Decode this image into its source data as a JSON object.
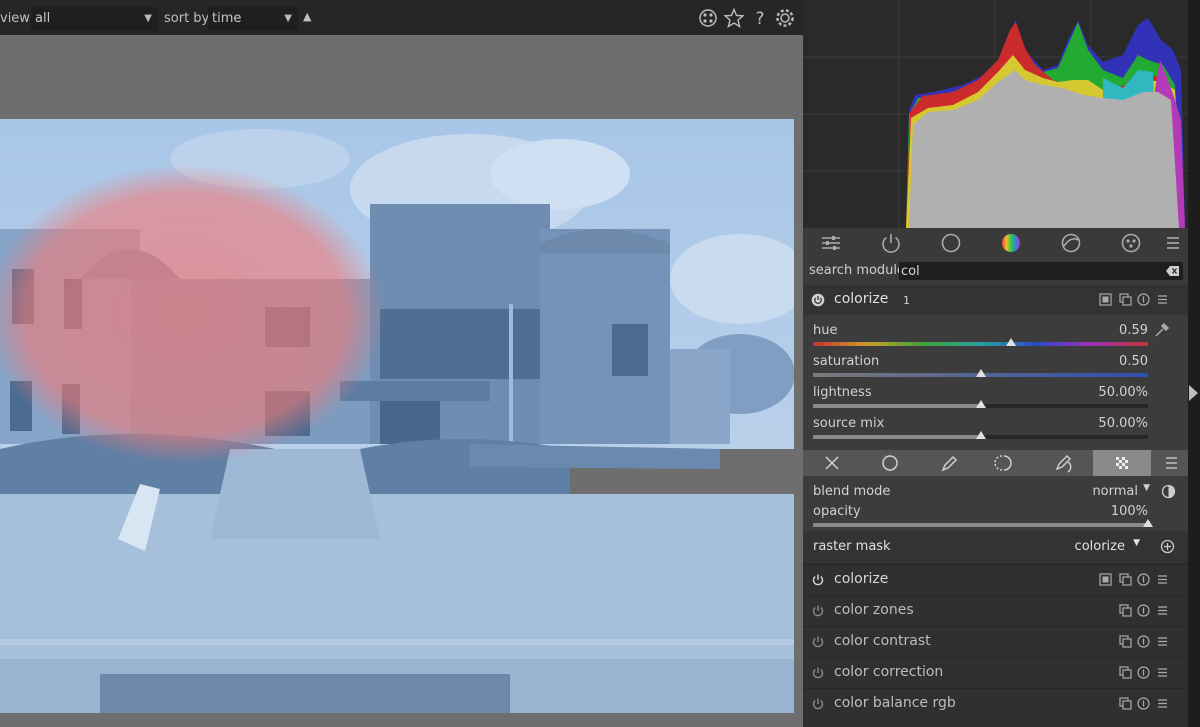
{
  "topbar": {
    "view_label": "view",
    "view_value": "all",
    "sort_label": "sort by",
    "sort_value": "time",
    "sort_direction": "▲"
  },
  "search": {
    "label": "search module",
    "value": "col"
  },
  "expanded_module": {
    "name": "colorize",
    "instance": "1",
    "sliders": [
      {
        "label": "hue",
        "value": "0.59",
        "fraction": 0.59
      },
      {
        "label": "saturation",
        "value": "0.50",
        "fraction": 0.5
      },
      {
        "label": "lightness",
        "value": "50.00%",
        "fraction": 0.5
      },
      {
        "label": "source mix",
        "value": "50.00%",
        "fraction": 0.5
      }
    ],
    "blend_mode_label": "blend mode",
    "blend_mode_value": "normal",
    "opacity_label": "opacity",
    "opacity_value": "100%",
    "opacity_fraction": 1.0,
    "raster_mask_label": "raster mask",
    "raster_mask_value": "colorize"
  },
  "modules": [
    {
      "name": "colorize",
      "enabled": true
    },
    {
      "name": "color zones",
      "enabled": false
    },
    {
      "name": "color contrast",
      "enabled": false
    },
    {
      "name": "color correction",
      "enabled": false
    },
    {
      "name": "color balance rgb",
      "enabled": false
    }
  ],
  "colors": {
    "photo_tint": "#9fbde0",
    "mask_overlay": "#f07a78",
    "panel_bg": "#303030"
  }
}
